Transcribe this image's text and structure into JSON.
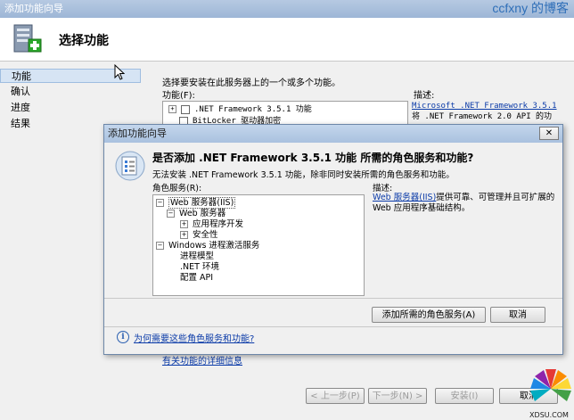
{
  "window": {
    "title": "添加功能向导",
    "watermark": "ccfxny 的博客"
  },
  "header": {
    "title": "选择功能"
  },
  "nav": {
    "items": [
      "功能",
      "确认",
      "进度",
      "结果"
    ],
    "selected": 0
  },
  "main": {
    "instruction": "选择要安装在此服务器上的一个或多个功能。",
    "features_label": "功能(F):",
    "features": [
      ".NET Framework 3.5.1 功能",
      "BitLocker 驱动器加密"
    ],
    "desc_label": "描述:",
    "desc_link": "Microsoft .NET Framework 3.5.1",
    "desc_text": "将 .NET Framework 2.0 API 的功",
    "detail_link": "有关功能的详细信息",
    "buttons": {
      "prev": "< 上一步(P)",
      "next": "下一步(N) >",
      "install": "安装(I)",
      "cancel": "取消"
    }
  },
  "dialog": {
    "title": "添加功能向导",
    "close": "✕",
    "question": "是否添加 .NET Framework 3.5.1 功能 所需的角色服务和功能?",
    "subtext": "无法安装 .NET Framework 3.5.1 功能，除非同时安装所需的角色服务和功能。",
    "roles_label": "角色服务(R):",
    "tree": {
      "web_server": "Web 服务器(IIS)",
      "web_sub": "Web 服务器",
      "app_dev": "应用程序开发",
      "security": "安全性",
      "was": "Windows 进程激活服务",
      "process_model": "进程模型",
      "net_env": ".NET 环境",
      "config_api": "配置 API"
    },
    "desc_label": "描述:",
    "desc_link": "Web 服务器(IIS)",
    "desc_text": "提供可靠、可管理并且可扩展的 Web 应用程序基础结构。",
    "add_button": "添加所需的角色服务(A)",
    "cancel_button": "取消",
    "info_link": "为何需要这些角色服务和功能?"
  },
  "logo": {
    "text": "XDSU.COM"
  }
}
